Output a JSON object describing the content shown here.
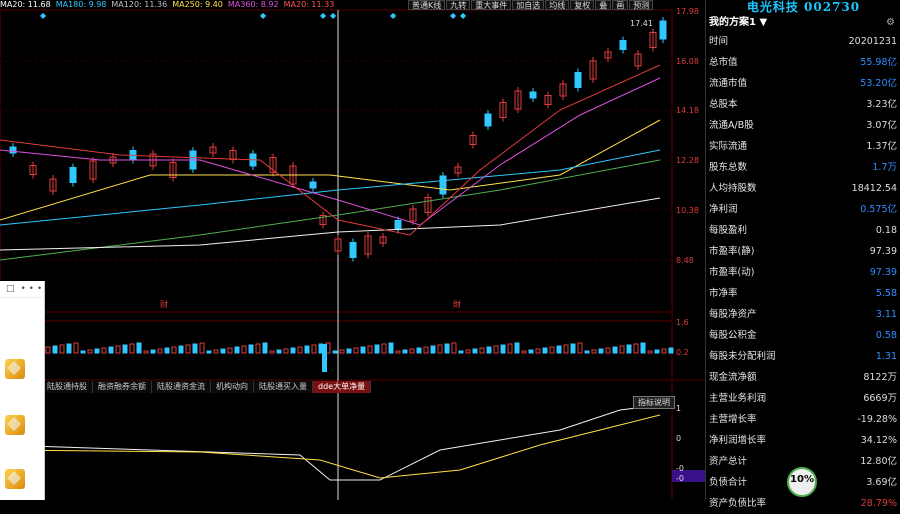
{
  "ma_legend": [
    {
      "label": "MA20: 11.68",
      "color": "#ffffff"
    },
    {
      "label": "MA180: 9.98",
      "color": "#2fc8ff"
    },
    {
      "label": "MA120: 11.36",
      "color": "#c0c0c0"
    },
    {
      "label": "MA250: 9.40",
      "color": "#ffe14a"
    },
    {
      "label": "MA360: 8.92",
      "color": "#e050e0"
    },
    {
      "label": "MA20: 11.33",
      "color": "#ff5555"
    }
  ],
  "toolbar": [
    "普通K线",
    "九转",
    "重大事件",
    "加自选",
    "均线",
    "复权",
    "叠",
    "画",
    "预测"
  ],
  "price_axis": [
    "17.98",
    "16.08",
    "14.18",
    "12.28",
    "10.38",
    "8.48"
  ],
  "volume_axis": [
    "1.6",
    "0.2"
  ],
  "indicator_axis": [
    "1",
    "0",
    "-0",
    "-0"
  ],
  "peak_label": "17.41",
  "markers": [
    "财",
    "財"
  ],
  "bottom_tabs": [
    "陆股通持股",
    "融资融券余额",
    "陆股通资金流",
    "机构动向",
    "陆股通买入量",
    "dde大单净量"
  ],
  "active_tab": "dde大单净量",
  "indicator_button": "指标说明",
  "float_panel": {
    "dots": "• • •",
    "square": "□"
  },
  "right_panel": {
    "title": "电光科技 002730",
    "plan": "我的方案1 ▼",
    "gear": "⚙",
    "rows": [
      {
        "k": "时间",
        "v": "20201231",
        "c": ""
      },
      {
        "k": "总市值",
        "v": "55.98亿",
        "c": "blue"
      },
      {
        "k": "流通市值",
        "v": "53.20亿",
        "c": "blue"
      },
      {
        "k": "总股本",
        "v": "3.23亿",
        "c": ""
      },
      {
        "k": "流通A/B股",
        "v": "3.07亿",
        "c": ""
      },
      {
        "k": "实际流通",
        "v": "1.37亿",
        "c": ""
      },
      {
        "k": "股东总数",
        "v": "1.7万",
        "c": "blue"
      },
      {
        "k": "人均持股数",
        "v": "18412.54",
        "c": ""
      },
      {
        "k": "净利润",
        "v": "0.575亿",
        "c": "blue"
      },
      {
        "k": "每股盈利",
        "v": "0.18",
        "c": ""
      },
      {
        "k": "市盈率(静)",
        "v": "97.39",
        "c": ""
      },
      {
        "k": "市盈率(动)",
        "v": "97.39",
        "c": "blue"
      },
      {
        "k": "市净率",
        "v": "5.58",
        "c": "blue"
      },
      {
        "k": "每股净资产",
        "v": "3.11",
        "c": "blue"
      },
      {
        "k": "每股公积金",
        "v": "0.58",
        "c": "blue"
      },
      {
        "k": "每股未分配利润",
        "v": "1.31",
        "c": "blue"
      },
      {
        "k": "现金流净额",
        "v": "8122万",
        "c": ""
      },
      {
        "k": "主营业务利润",
        "v": "6669万",
        "c": ""
      },
      {
        "k": "主营增长率",
        "v": "-19.28%",
        "c": ""
      },
      {
        "k": "净利润增长率",
        "v": "34.12%",
        "c": ""
      },
      {
        "k": "资产总计",
        "v": "12.80亿",
        "c": ""
      },
      {
        "k": "负债合计",
        "v": "3.69亿",
        "c": ""
      },
      {
        "k": "资产负债比率",
        "v": "28.79%",
        "c": "red"
      }
    ],
    "badge": "10%"
  }
}
